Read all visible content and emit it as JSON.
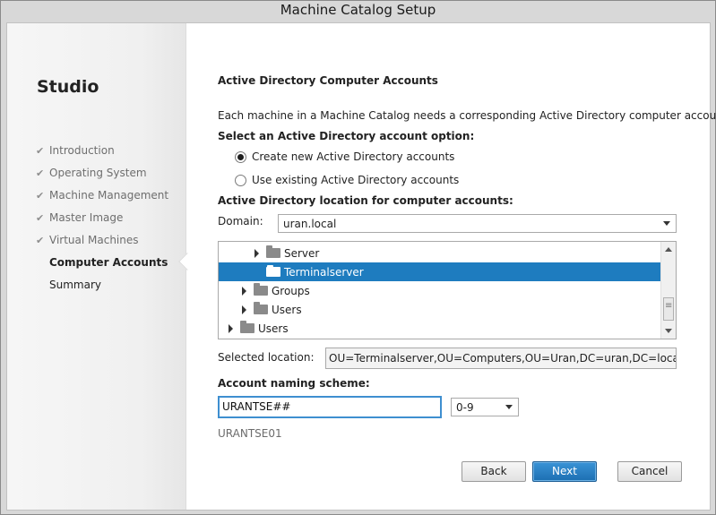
{
  "window": {
    "title": "Machine Catalog Setup"
  },
  "sidebar": {
    "app_name": "Studio",
    "steps": [
      {
        "label": "Introduction",
        "state": "done"
      },
      {
        "label": "Operating System",
        "state": "done"
      },
      {
        "label": "Machine Management",
        "state": "done"
      },
      {
        "label": "Master Image",
        "state": "done"
      },
      {
        "label": "Virtual Machines",
        "state": "done"
      },
      {
        "label": "Computer Accounts",
        "state": "current"
      },
      {
        "label": "Summary",
        "state": "pending"
      }
    ],
    "check_glyph": "✔"
  },
  "main": {
    "heading": "Active Directory Computer Accounts",
    "description": "Each machine in a Machine Catalog needs a corresponding Active Directory computer account.",
    "account_option_label": "Select an Active Directory account option:",
    "options": [
      {
        "label": "Create new Active Directory accounts",
        "selected": true
      },
      {
        "label": "Use existing Active Directory accounts",
        "selected": false
      }
    ],
    "location_label": "Active Directory location for computer accounts:",
    "domain_label": "Domain:",
    "domain_value": "uran.local",
    "tree": [
      {
        "label": "Server",
        "expandable": true,
        "selected": false
      },
      {
        "label": "Terminalserver",
        "expandable": false,
        "selected": true
      },
      {
        "label": "Groups",
        "expandable": true,
        "selected": false
      },
      {
        "label": "Users",
        "expandable": true,
        "selected": false
      },
      {
        "label": "Users",
        "expandable": true,
        "selected": false
      }
    ],
    "selected_location_label": "Selected location:",
    "selected_location_value": "OU=Terminalserver,OU=Computers,OU=Uran,DC=uran,DC=local",
    "naming_label": "Account naming scheme:",
    "naming_value": "URANTSE##",
    "naming_type_value": "0-9",
    "naming_preview": "URANTSE01"
  },
  "buttons": {
    "back": "Back",
    "next": "Next",
    "cancel": "Cancel"
  },
  "colors": {
    "selection": "#1e7cbf",
    "primary_button": "#2a82c6",
    "focus_border": "#3e8fd0"
  }
}
